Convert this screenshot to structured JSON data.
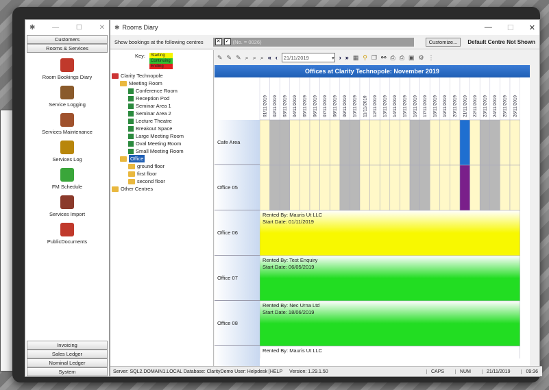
{
  "left_panel": {
    "top_tabs": [
      "Customers",
      "Rooms & Services"
    ],
    "items": [
      {
        "label": "Room Bookings Diary",
        "icon": "calendar-icon",
        "color": "#c0392b"
      },
      {
        "label": "Service Logging",
        "icon": "people-icon",
        "color": "#8a5a2b"
      },
      {
        "label": "Services Maintenance",
        "icon": "briefcase-icon",
        "color": "#a0522d"
      },
      {
        "label": "Services Log",
        "icon": "clipboard-icon",
        "color": "#b8860b"
      },
      {
        "label": "FM Schedule",
        "icon": "clock-icon",
        "color": "#3aa63a"
      },
      {
        "label": "Services Import",
        "icon": "briefcase-import-icon",
        "color": "#8b3a2b"
      },
      {
        "label": "PublicDocuments",
        "icon": "documents-icon",
        "color": "#c0392b"
      }
    ],
    "bottom_tabs": [
      "Invoicing",
      "Sales Ledger",
      "Nominal Ledger",
      "System"
    ]
  },
  "main": {
    "title": "Rooms Diary",
    "show_bookings_label": "Show bookings at the following centres",
    "centres_value": "(No. = 0026)",
    "customize_label": "Customize...",
    "default_centre_label": "Default Centre Not Shown",
    "key_label": "Key:",
    "key_items": [
      {
        "label": "Starting",
        "color": "#f5f500"
      },
      {
        "label": "Continuing",
        "color": "#2fc02f"
      },
      {
        "label": "Ending",
        "color": "#e02020"
      }
    ],
    "tree": [
      {
        "label": "Clarity Technopole",
        "level": 0,
        "type": "root"
      },
      {
        "label": "Meeting Room",
        "level": 1,
        "type": "folder"
      },
      {
        "label": "Conference Room",
        "level": 2,
        "type": "room"
      },
      {
        "label": "Reception Pod",
        "level": 2,
        "type": "room"
      },
      {
        "label": "Seminar Area 1",
        "level": 2,
        "type": "room"
      },
      {
        "label": "Seminar Area 2",
        "level": 2,
        "type": "room"
      },
      {
        "label": "Lecture Theatre",
        "level": 2,
        "type": "room"
      },
      {
        "label": "Breakout Space",
        "level": 2,
        "type": "room"
      },
      {
        "label": "Large Meeting Room",
        "level": 2,
        "type": "room"
      },
      {
        "label": "Oval Meeting Room",
        "level": 2,
        "type": "room"
      },
      {
        "label": "Small Meeting Room",
        "level": 2,
        "type": "room"
      },
      {
        "label": "Office",
        "level": 1,
        "type": "folder",
        "selected": true
      },
      {
        "label": "ground floor",
        "level": 2,
        "type": "folder"
      },
      {
        "label": "first floor",
        "level": 2,
        "type": "folder"
      },
      {
        "label": "second floor",
        "level": 2,
        "type": "folder"
      },
      {
        "label": "Other Centres",
        "level": 0,
        "type": "folder"
      }
    ],
    "date_value": "21/11/2019",
    "grid_title": "Offices at Clarity Technopole: November 2019",
    "dates": [
      "01/11/2019",
      "02/11/2019",
      "03/11/2019",
      "04/11/2019",
      "05/11/2019",
      "06/11/2019",
      "07/11/2019",
      "08/11/2019",
      "09/11/2019",
      "10/11/2019",
      "11/11/2019",
      "12/11/2019",
      "13/11/2019",
      "14/11/2019",
      "15/11/2019",
      "16/11/2019",
      "17/11/2019",
      "18/11/2019",
      "19/11/2019",
      "20/11/2019",
      "21/11/2019",
      "22/11/2019",
      "23/11/2019",
      "24/11/2019",
      "25/11/2019",
      "26/11/2019"
    ],
    "weekend_indexes": [
      1,
      2,
      8,
      9,
      15,
      16,
      22,
      23
    ],
    "rows": [
      {
        "label": "Cafe Area",
        "booking": null,
        "fill": "#fff8c8",
        "marker_color": "#1f6fd0"
      },
      {
        "label": "Office 05",
        "booking": null,
        "fill": "#fff8c8",
        "marker_color": "#7a1f8a"
      },
      {
        "label": "Office 06",
        "rented_by": "Rented By: Mauris Ut LLC",
        "start_date": "Start Date: 01/11/2019",
        "fill": "#f8f800"
      },
      {
        "label": "Office 07",
        "rented_by": "Rented By: Test Enquiry",
        "start_date": "Start Date: 06/05/2019",
        "fill": "#22dd22"
      },
      {
        "label": "Office 08",
        "rented_by": "Rented By: Nec Urna Ltd",
        "start_date": "Start Date: 18/06/2019",
        "fill": "#22dd22"
      },
      {
        "label": "",
        "rented_by": "Rented By: Mauris Ut LLC",
        "start_date": "",
        "fill": "#ffffff"
      }
    ],
    "status": {
      "server": "Server: SQL2.DOMAIN1.LOCAL Database: ClarityDemo User: Helpdesk [HELP",
      "version": "Version: 1.29.1.50",
      "caps": "CAPS",
      "num": "NUM",
      "date": "21/11/2019",
      "time": "09:36"
    }
  }
}
